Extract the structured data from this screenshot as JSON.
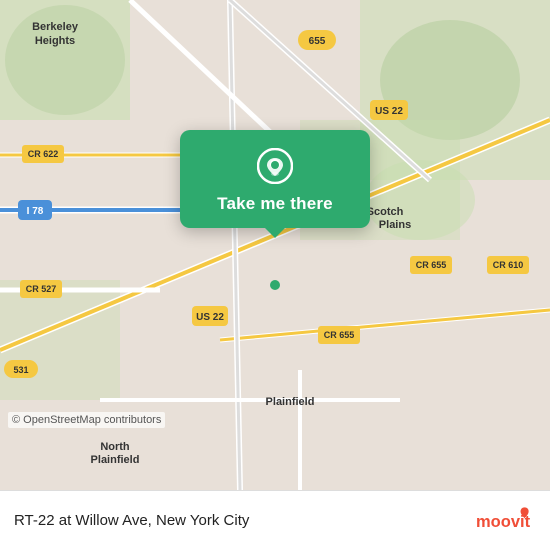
{
  "map": {
    "alt": "Map of RT-22 at Willow Ave, New York City area",
    "copyright": "© OpenStreetMap contributors"
  },
  "popup": {
    "button_label": "Take me there"
  },
  "bottom_bar": {
    "location_title": "RT-22 at Willow Ave, New York City"
  },
  "colors": {
    "popup_bg": "#2eaa6e",
    "road_yellow": "#f5c842",
    "road_white": "#ffffff",
    "land_green": "#c8ddb0",
    "land_tan": "#e8e0d8",
    "water": "#b8d4e8"
  }
}
